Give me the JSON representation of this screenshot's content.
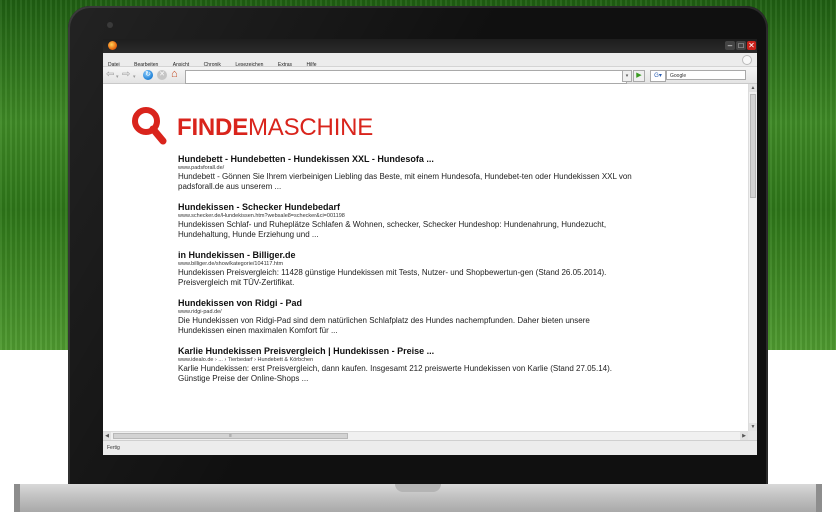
{
  "browser": {
    "menu": [
      "Datei",
      "Bearbeiten",
      "Ansicht",
      "Chronik",
      "Lesezeichen",
      "Extras",
      "Hilfe"
    ],
    "search_box_value": "Google",
    "status": "Fertig",
    "url_value": ""
  },
  "page": {
    "logo": {
      "bold": "FINDE",
      "light": "MASCHINE"
    },
    "results": [
      {
        "title": "Hundebett - Hundebetten - Hundekissen XXL - Hundesofa ...",
        "url": "www.padsforall.de/",
        "snippet": "Hundebett - Gönnen Sie Ihrem vierbeinigen Liebling das Beste, mit einem Hundesofa, Hundebet-ten oder Hundekissen XXL von padsforall.de aus unserem ..."
      },
      {
        "title": "Hundekissen - Schecker Hundebedarf",
        "url": "www.schecker.de/Hundekissen.htm?websale8=schecker&ci=001198",
        "snippet": "Hundekissen Schlaf- und Ruheplätze Schlafen & Wohnen, schecker, Schecker Hundeshop: Hundenahrung, Hundezucht, Hundehaltung, Hunde Erziehung und ..."
      },
      {
        "title": "in Hundekissen - Billiger.de",
        "url": "www.billiger.de/show/kategorie/104117.htm",
        "snippet": "Hundekissen Preisvergleich: 11428 günstige Hundekissen mit Tests, Nutzer- und Shopbewertun-gen (Stand 26.05.2014). Preisvergleich mit TÜV-Zertifikat."
      },
      {
        "title": "Hundekissen von Ridgi - Pad",
        "url": "www.ridgi-pad.de/",
        "snippet": "Die Hundekissen von Ridgi-Pad sind dem natürlichen Schlafplatz des Hundes nachempfunden. Daher bieten unsere Hundekissen einen maximalen Komfort für ..."
      },
      {
        "title": "Karlie Hundekissen Preisvergleich | Hundekissen - Preise ...",
        "url": "www.idealo.de › ... › Tierbedarf › Hundebett & Körbchen",
        "snippet": "Karlie Hundekissen: erst Preisvergleich, dann kaufen. Insgesamt 212 preiswerte Hundekissen von Karlie (Stand 27.05.14). Günstige Preise der Online-Shops ..."
      }
    ]
  },
  "colors": {
    "brand_red": "#d9241c",
    "grass": "#3f8a26",
    "bezel": "#101010"
  },
  "icons": {
    "back": "back-arrow-icon",
    "forward": "forward-arrow-icon",
    "reload": "reload-icon",
    "stop": "stop-icon",
    "home": "home-icon",
    "search_engine": "google-icon",
    "logo": "magnifier-icon"
  }
}
